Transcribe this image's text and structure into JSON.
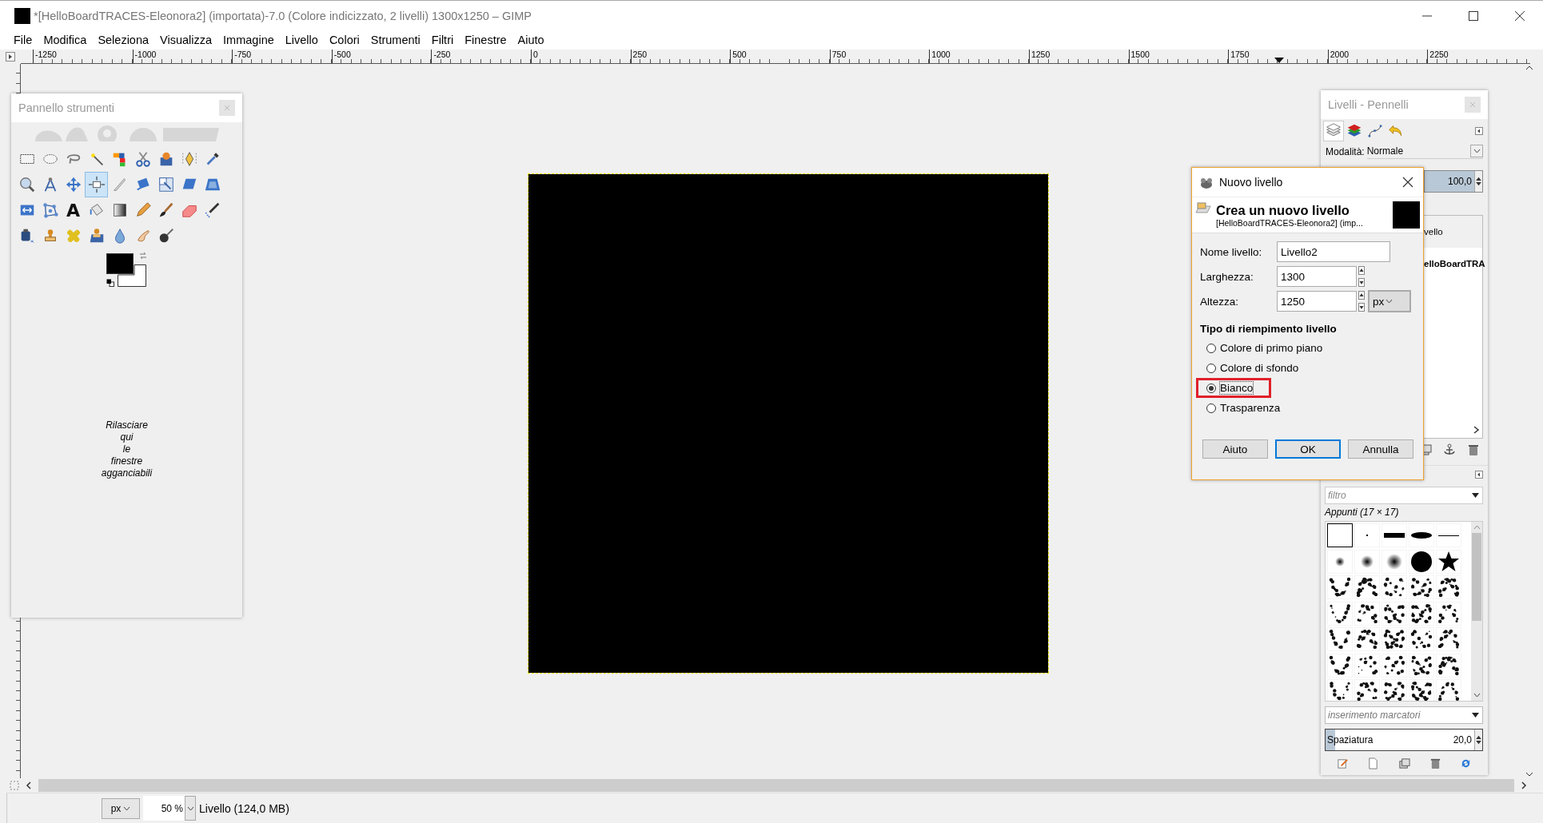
{
  "window": {
    "title": "*[HelloBoardTRACES-Eleonora2] (importata)-7.0 (Colore indicizzato, 2 livelli) 1300x1250 – GIMP"
  },
  "menu": [
    "File",
    "Modifica",
    "Seleziona",
    "Visualizza",
    "Immagine",
    "Livello",
    "Colori",
    "Strumenti",
    "Filtri",
    "Finestre",
    "Aiuto"
  ],
  "ruler": {
    "labels": [
      "-1250",
      "-1000",
      "-750",
      "-500",
      "-250",
      "0",
      "250",
      "500",
      "750",
      "1000",
      "1250",
      "1500",
      "1750",
      "2000",
      "2250"
    ]
  },
  "toolbox": {
    "title": "Pannello strumenti",
    "tools": [
      {
        "selected": false
      },
      {
        "selected": false
      },
      {
        "selected": false
      },
      {
        "selected": false
      },
      {
        "selected": false
      },
      {
        "selected": false
      },
      {
        "selected": false
      },
      {
        "selected": false
      },
      {
        "selected": false
      },
      {
        "selected": false
      },
      {
        "selected": false
      },
      {
        "selected": false
      },
      {
        "selected": true
      },
      {
        "selected": false
      },
      {
        "selected": false
      },
      {
        "selected": false
      },
      {
        "selected": false
      },
      {
        "selected": false
      },
      {
        "selected": false
      },
      {
        "selected": false
      },
      {
        "selected": false,
        "glyph": "A"
      },
      {
        "selected": false
      },
      {
        "selected": false
      },
      {
        "selected": false
      },
      {
        "selected": false
      },
      {
        "selected": false
      },
      {
        "selected": false
      },
      {
        "selected": false
      },
      {
        "selected": false
      },
      {
        "selected": false
      },
      {
        "selected": false
      },
      {
        "selected": false
      },
      {
        "selected": false
      },
      {
        "selected": false
      }
    ],
    "drop_hint": "Rilasciare qui le finestre agganciabili"
  },
  "dock": {
    "title": "Livelli - Pennelli",
    "tabs": [
      {
        "selected": true
      },
      {
        "selected": false
      },
      {
        "selected": false
      },
      {
        "selected": false
      }
    ],
    "mode": {
      "label": "Modalità:",
      "value": "Normale"
    },
    "opacity": {
      "value": "100,0",
      "level": 1
    },
    "layers": [
      {
        "name": "vello",
        "bold": false
      },
      {
        "name": "elloBoardTRA",
        "bold": true
      }
    ],
    "brushes": {
      "filter_placeholder": "filtro",
      "caption": "Appunti (17 × 17)",
      "items": [
        {
          "kind": "blank",
          "selected": true
        },
        {
          "kind": "pixel",
          "selected": false
        },
        {
          "kind": "bar",
          "selected": false
        },
        {
          "kind": "ellipse",
          "selected": false
        },
        {
          "kind": "line",
          "selected": false
        },
        {
          "kind": "blur",
          "selected": false
        },
        {
          "kind": "blur",
          "selected": false
        },
        {
          "kind": "blur",
          "selected": false
        },
        {
          "kind": "disc",
          "selected": false
        },
        {
          "kind": "star",
          "selected": false
        },
        {
          "kind": "splatter",
          "selected": false
        },
        {
          "kind": "splatter",
          "selected": false
        },
        {
          "kind": "splatter",
          "selected": false
        },
        {
          "kind": "splatter",
          "selected": false
        },
        {
          "kind": "splatter",
          "selected": false
        },
        {
          "kind": "splatter",
          "selected": false
        },
        {
          "kind": "splatter",
          "selected": false
        },
        {
          "kind": "splatter",
          "selected": false
        },
        {
          "kind": "splatter",
          "selected": false
        },
        {
          "kind": "splatter",
          "selected": false
        },
        {
          "kind": "splatter",
          "selected": false
        },
        {
          "kind": "splatter",
          "selected": false
        },
        {
          "kind": "splatter",
          "selected": false
        },
        {
          "kind": "splatter",
          "selected": false
        },
        {
          "kind": "splatter",
          "selected": false
        },
        {
          "kind": "splatter",
          "selected": false
        },
        {
          "kind": "splatter",
          "selected": false
        },
        {
          "kind": "splatter",
          "selected": false
        },
        {
          "kind": "splatter",
          "selected": false
        },
        {
          "kind": "splatter",
          "selected": false
        },
        {
          "kind": "splatter",
          "selected": false
        },
        {
          "kind": "splatter",
          "selected": false
        },
        {
          "kind": "splatter",
          "selected": false
        },
        {
          "kind": "splatter",
          "selected": false
        },
        {
          "kind": "splatter",
          "selected": false
        }
      ],
      "tag_placeholder": "inserimento marcatori",
      "spacing": {
        "label": "Spaziatura",
        "value": "20,0",
        "level": 0.06
      }
    }
  },
  "dialog": {
    "title": "Nuovo livello",
    "heading": "Crea un nuovo livello",
    "subtitle": "[HelloBoardTRACES-Eleonora2] (imp...",
    "fields": [
      {
        "kind": "text",
        "label": "Nome livello:",
        "value": "Livello2"
      },
      {
        "kind": "spin",
        "label": "Larghezza:",
        "value": "1300"
      },
      {
        "kind": "spin",
        "label": "Altezza:",
        "value": "1250",
        "unit": "px"
      }
    ],
    "fill_heading": "Tipo di riempimento livello",
    "fill_options": [
      {
        "label": "Colore di primo piano",
        "selected": false,
        "highlighted": false
      },
      {
        "label": "Colore di sfondo",
        "selected": false,
        "highlighted": false
      },
      {
        "label": "Bianco",
        "selected": true,
        "highlighted": true
      },
      {
        "label": "Trasparenza",
        "selected": false,
        "highlighted": false
      }
    ],
    "buttons": [
      {
        "label": "Aiuto",
        "default": false
      },
      {
        "label": "OK",
        "default": true
      },
      {
        "label": "Annulla",
        "default": false
      }
    ]
  },
  "status_bar": {
    "unit": "px",
    "zoom": "50 %",
    "info": "Livello (124,0 MB)"
  }
}
